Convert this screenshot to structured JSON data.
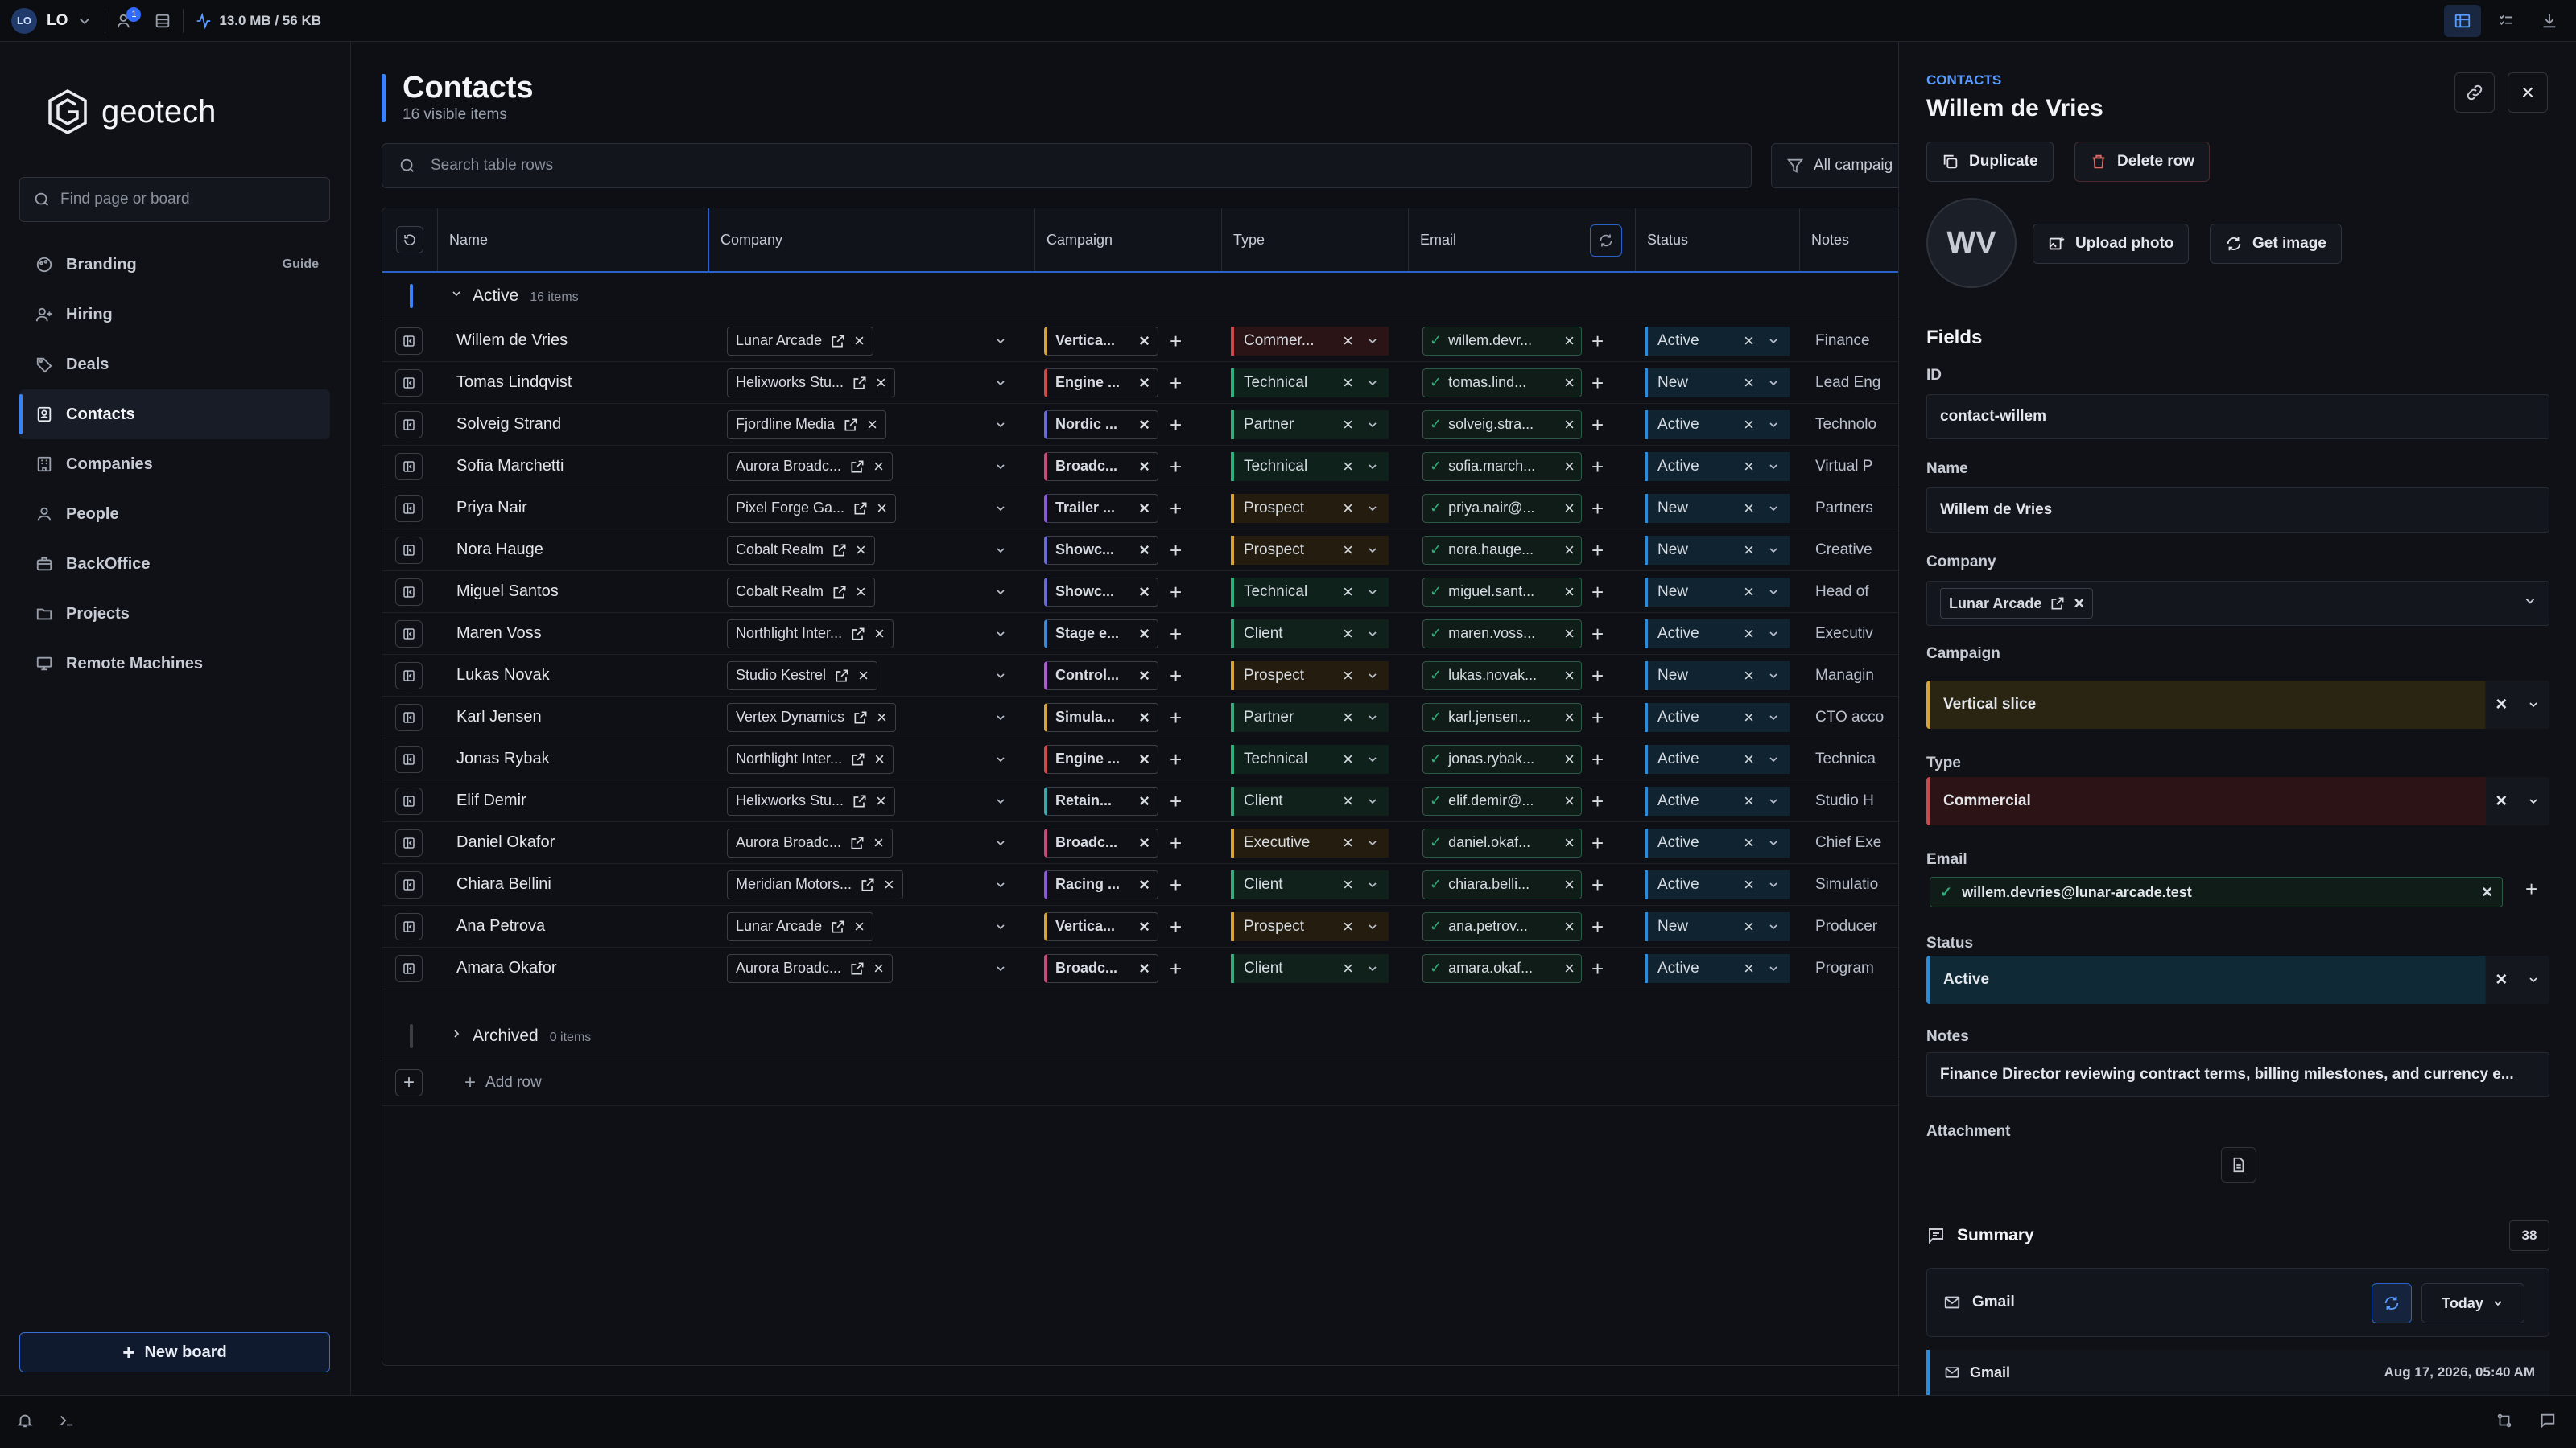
{
  "topbar": {
    "user_initials": "LO",
    "user_label": "LO",
    "notif_count": "1",
    "memory": "13.0 MB / 56 KB"
  },
  "sidebar": {
    "brand": "geotech",
    "search_placeholder": "Find page or board",
    "items": [
      {
        "label": "Branding",
        "badge": "Guide"
      },
      {
        "label": "Hiring"
      },
      {
        "label": "Deals"
      },
      {
        "label": "Contacts"
      },
      {
        "label": "Companies"
      },
      {
        "label": "People"
      },
      {
        "label": "BackOffice"
      },
      {
        "label": "Projects"
      },
      {
        "label": "Remote Machines"
      }
    ],
    "new_board": "New board"
  },
  "main": {
    "title": "Contacts",
    "subtitle": "16 visible items",
    "search_placeholder": "Search table rows",
    "filter_label": "All campaig",
    "columns": [
      "Name",
      "Company",
      "Campaign",
      "Type",
      "Email",
      "Status",
      "Notes"
    ],
    "group_active": {
      "label": "Active",
      "count": "16 items"
    },
    "group_archived": {
      "label": "Archived",
      "count": "0 items"
    },
    "add_row": "Add row",
    "rows": [
      {
        "name": "Willem de Vries",
        "company": "Lunar Arcade",
        "campaign": "Vertica...",
        "camp_color": "#d6a23a",
        "type": "Commer...",
        "type_color": "#c94a4a",
        "type_bg": "#2a1416",
        "email": "willem.devr...",
        "status": "Active",
        "notes": "Finance"
      },
      {
        "name": "Tomas Lindqvist",
        "company": "Helixworks Stu...",
        "campaign": "Engine ...",
        "camp_color": "#d04a4a",
        "type": "Technical",
        "type_color": "#2fae7a",
        "type_bg": "#0e221b",
        "email": "tomas.lind...",
        "status": "New",
        "notes": "Lead Eng"
      },
      {
        "name": "Solveig Strand",
        "company": "Fjordline Media",
        "campaign": "Nordic ...",
        "camp_color": "#6b6bd6",
        "type": "Partner",
        "type_color": "#3aa87a",
        "type_bg": "#0f211a",
        "email": "solveig.stra...",
        "status": "Active",
        "notes": "Technolo"
      },
      {
        "name": "Sofia Marchetti",
        "company": "Aurora Broadc...",
        "campaign": "Broadc...",
        "camp_color": "#c94a7a",
        "type": "Technical",
        "type_color": "#2fae7a",
        "type_bg": "#0e221b",
        "email": "sofia.march...",
        "status": "Active",
        "notes": "Virtual P"
      },
      {
        "name": "Priya Nair",
        "company": "Pixel Forge Ga...",
        "campaign": "Trailer ...",
        "camp_color": "#8a5ad6",
        "type": "Prospect",
        "type_color": "#d6a23a",
        "type_bg": "#241c0e",
        "email": "priya.nair@...",
        "status": "New",
        "notes": "Partners"
      },
      {
        "name": "Nora Hauge",
        "company": "Cobalt Realm",
        "campaign": "Showc...",
        "camp_color": "#6b6bd6",
        "type": "Prospect",
        "type_color": "#d6a23a",
        "type_bg": "#241c0e",
        "email": "nora.hauge...",
        "status": "New",
        "notes": "Creative"
      },
      {
        "name": "Miguel Santos",
        "company": "Cobalt Realm",
        "campaign": "Showc...",
        "camp_color": "#6b6bd6",
        "type": "Technical",
        "type_color": "#2fae7a",
        "type_bg": "#0e221b",
        "email": "miguel.sant...",
        "status": "New",
        "notes": "Head of"
      },
      {
        "name": "Maren Voss",
        "company": "Northlight Inter...",
        "campaign": "Stage e...",
        "camp_color": "#3a8ad6",
        "type": "Client",
        "type_color": "#3aa87a",
        "type_bg": "#0f211a",
        "email": "maren.voss...",
        "status": "Active",
        "notes": "Executiv"
      },
      {
        "name": "Lukas Novak",
        "company": "Studio Kestrel",
        "campaign": "Control...",
        "camp_color": "#b05ad6",
        "type": "Prospect",
        "type_color": "#d6a23a",
        "type_bg": "#241c0e",
        "email": "lukas.novak...",
        "status": "New",
        "notes": "Managin"
      },
      {
        "name": "Karl Jensen",
        "company": "Vertex Dynamics",
        "campaign": "Simula...",
        "camp_color": "#d6a23a",
        "type": "Partner",
        "type_color": "#3aa87a",
        "type_bg": "#0f211a",
        "email": "karl.jensen...",
        "status": "Active",
        "notes": "CTO acco"
      },
      {
        "name": "Jonas Rybak",
        "company": "Northlight Inter...",
        "campaign": "Engine ...",
        "camp_color": "#d04a4a",
        "type": "Technical",
        "type_color": "#2fae7a",
        "type_bg": "#0e221b",
        "email": "jonas.rybak...",
        "status": "Active",
        "notes": "Technica"
      },
      {
        "name": "Elif Demir",
        "company": "Helixworks Stu...",
        "campaign": "Retain...",
        "camp_color": "#3aa8a8",
        "type": "Client",
        "type_color": "#3aa87a",
        "type_bg": "#0f211a",
        "email": "elif.demir@...",
        "status": "Active",
        "notes": "Studio H"
      },
      {
        "name": "Daniel Okafor",
        "company": "Aurora Broadc...",
        "campaign": "Broadc...",
        "camp_color": "#c94a7a",
        "type": "Executive",
        "type_color": "#d6a23a",
        "type_bg": "#241c0e",
        "email": "daniel.okaf...",
        "status": "Active",
        "notes": "Chief Exe"
      },
      {
        "name": "Chiara Bellini",
        "company": "Meridian Motors...",
        "campaign": "Racing ...",
        "camp_color": "#8a5ad6",
        "type": "Client",
        "type_color": "#3aa87a",
        "type_bg": "#0f211a",
        "email": "chiara.belli...",
        "status": "Active",
        "notes": "Simulatio"
      },
      {
        "name": "Ana Petrova",
        "company": "Lunar Arcade",
        "campaign": "Vertica...",
        "camp_color": "#d6a23a",
        "type": "Prospect",
        "type_color": "#d6a23a",
        "type_bg": "#241c0e",
        "email": "ana.petrov...",
        "status": "New",
        "notes": "Producer"
      },
      {
        "name": "Amara Okafor",
        "company": "Aurora Broadc...",
        "campaign": "Broadc...",
        "camp_color": "#c94a7a",
        "type": "Client",
        "type_color": "#3aa87a",
        "type_bg": "#0f211a",
        "email": "amara.okaf...",
        "status": "Active",
        "notes": "Program"
      }
    ]
  },
  "panel": {
    "section": "CONTACTS",
    "title": "Willem de Vries",
    "duplicate": "Duplicate",
    "delete_row": "Delete row",
    "avatar_initials": "WV",
    "upload_photo": "Upload photo",
    "get_image": "Get image",
    "fields_heading": "Fields",
    "id_label": "ID",
    "id_value": "contact-willem",
    "name_label": "Name",
    "name_value": "Willem de Vries",
    "company_label": "Company",
    "company_value": "Lunar Arcade",
    "campaign_label": "Campaign",
    "campaign_value": "Vertical slice",
    "type_label": "Type",
    "type_value": "Commercial",
    "email_label": "Email",
    "email_value": "willem.devries@lunar-arcade.test",
    "status_label": "Status",
    "status_value": "Active",
    "notes_label": "Notes",
    "notes_value": "Finance Director reviewing contract terms, billing milestones, and currency e...",
    "attachment_label": "Attachment",
    "summary_label": "Summary",
    "summary_count": "38",
    "gmail_label": "Gmail",
    "today_label": "Today",
    "gmail_item_label": "Gmail",
    "gmail_item_date": "Aug 17, 2026, 05:40 AM"
  }
}
